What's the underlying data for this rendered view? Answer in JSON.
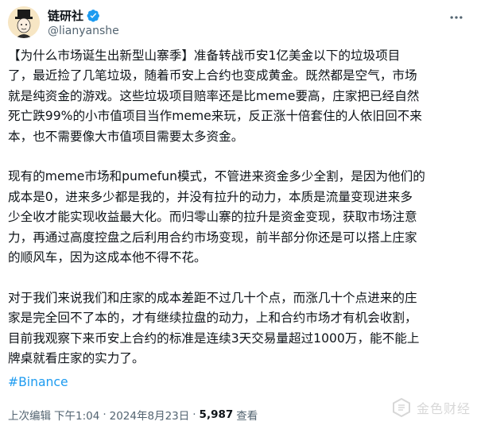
{
  "author": {
    "display_name": "链研社",
    "handle": "@lianyanshe"
  },
  "tweet": {
    "paragraphs": [
      [
        "【为什么市场诞生出新型山寨季】准备转战币安1亿美金以下的垃圾项目",
        "了，最近捡了几笔垃圾，随着币安上合约也变成黄金。既然都是空气，市场",
        "就是纯资金的游戏。这些垃圾项目赔率还是比meme要高，庄家把已经自然",
        "死亡跌99%的小市值项目当作meme来玩，反正涨十倍套住的人依旧回不来",
        "本，也不需要像大市值项目需要太多资金。"
      ],
      [
        "现有的meme市场和pumefun模式，不管进来资金多少全割，是因为他们的",
        "成本是0，进来多少都是我的，并没有拉升的动力，本质是流量变现进来多",
        "少全收才能实现收益最大化。而归零山寨的拉升是资金变现，获取市场注意",
        "力，再通过高度控盘之后利用合约市场变现，前半部分你还是可以搭上庄家",
        "的顺风车，因为这成本他不得不花。"
      ],
      [
        "对于我们来说我们和庄家的成本差距不过几十个点，而涨几十个点进来的庄",
        "家是完全回不了本的，才有继续拉盘的动力，上和合约市场才有机会收割，",
        "目前我观察下来币安上合约的标准是连续3天交易量超过1000万，能不能上",
        "牌桌就看庄家的实力了。"
      ]
    ],
    "hashtag": "#Binance"
  },
  "meta": {
    "edited_label": "上次编辑",
    "time": "下午1:04",
    "separator": "·",
    "date": "2024年8月23日",
    "views_count": "5,987",
    "views_label": "查看"
  },
  "watermark": {
    "text": "金色财经"
  },
  "colors": {
    "text": "#0f1419",
    "secondary": "#536471",
    "link": "#1d9bf0",
    "verified": "#1d9bf0"
  }
}
